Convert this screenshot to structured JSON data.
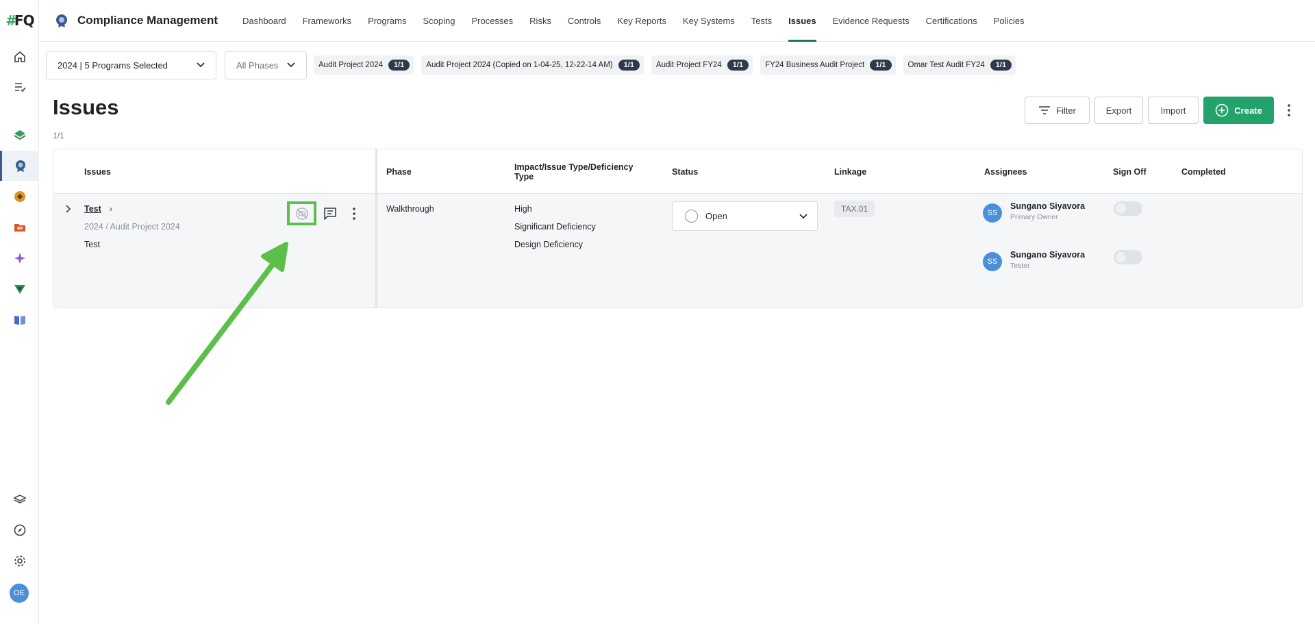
{
  "app": {
    "logo_hash": "#",
    "logo_text": "FQ",
    "title": "Compliance Management",
    "user_initials": "OE"
  },
  "nav": {
    "tabs": [
      {
        "label": "Dashboard"
      },
      {
        "label": "Frameworks"
      },
      {
        "label": "Programs"
      },
      {
        "label": "Scoping"
      },
      {
        "label": "Processes"
      },
      {
        "label": "Risks"
      },
      {
        "label": "Controls"
      },
      {
        "label": "Key Reports"
      },
      {
        "label": "Key Systems"
      },
      {
        "label": "Tests"
      },
      {
        "label": "Issues",
        "active": true
      },
      {
        "label": "Evidence Requests"
      },
      {
        "label": "Certifications"
      },
      {
        "label": "Policies"
      }
    ]
  },
  "filters": {
    "program_select": "2024 | 5 Programs Selected",
    "phase_select": "All Phases",
    "chips": [
      {
        "label": "Audit Project 2024",
        "count": "1/1"
      },
      {
        "label": "Audit Project 2024 (Copied on 1-04-25, 12-22-14 AM)",
        "count": "1/1"
      },
      {
        "label": "Audit Project FY24",
        "count": "1/1"
      },
      {
        "label": "FY24 Business Audit Project",
        "count": "1/1"
      },
      {
        "label": "Omar Test Audit FY24",
        "count": "1/1"
      }
    ]
  },
  "page": {
    "title": "Issues",
    "count": "1/1",
    "actions": {
      "filter": "Filter",
      "export": "Export",
      "import": "Import",
      "create": "Create"
    }
  },
  "table": {
    "columns": {
      "issues": "Issues",
      "phase": "Phase",
      "impact_line1": "Impact/Issue Type/Deficiency",
      "impact_line2": "Type",
      "status": "Status",
      "linkage": "Linkage",
      "assignees": "Assignees",
      "sign_off": "Sign Off",
      "completed": "Completed"
    },
    "rows": [
      {
        "title": "Test",
        "path": "2024 / Audit Project 2024",
        "description": "Test",
        "phase": "Walkthrough",
        "impact": "High",
        "issue_type": "Significant Deficiency",
        "deficiency_type": "Design Deficiency",
        "status": "Open",
        "linkage": "TAX.01",
        "assignees": [
          {
            "initials": "SS",
            "name": "Sungano Siyavora",
            "role": "Primary Owner",
            "signed_off": false
          },
          {
            "initials": "SS",
            "name": "Sungano Siyavora",
            "role": "Tester",
            "signed_off": false
          }
        ]
      }
    ]
  },
  "colors": {
    "brand_green": "#23a26b",
    "annotation_green": "#5bbf4a",
    "avatar_blue": "#4a8fd9",
    "chip_count_bg": "#2e3a4c"
  },
  "icons": {
    "row_actions": [
      "eye-off-icon",
      "comment-icon",
      "kebab-icon"
    ]
  }
}
